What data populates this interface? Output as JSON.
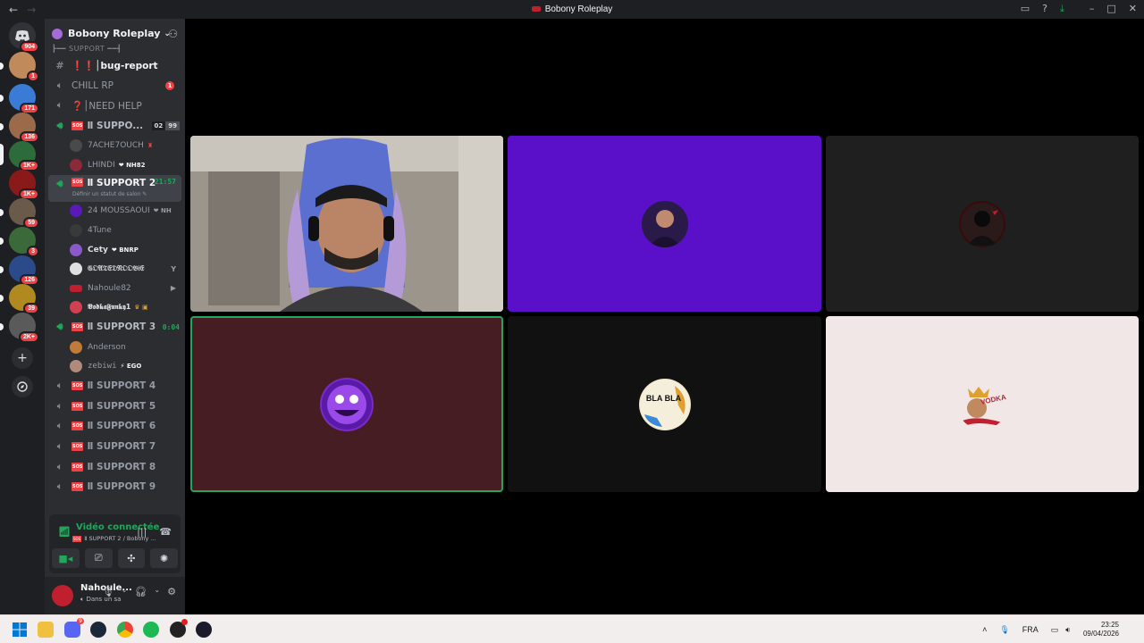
{
  "window": {
    "title": "Bobony Roleplay"
  },
  "guilds": [
    {
      "badge": "904",
      "color": "#5865f2"
    },
    {
      "badge": "1",
      "color": "#c08a5a"
    },
    {
      "badge": "171",
      "color": "#3a7bd5"
    },
    {
      "badge": "136",
      "color": "#9a6a4a"
    },
    {
      "badge": "1K+",
      "color": "#2e6b3a"
    },
    {
      "badge": "1K+",
      "color": "#8a1a1a"
    },
    {
      "badge": "59",
      "color": "#6a5a4a"
    },
    {
      "badge": "3",
      "color": "#3a6a3a"
    },
    {
      "badge": "126",
      "color": "#2a4a8a"
    },
    {
      "badge": "39",
      "color": "#b08a20"
    },
    {
      "badge": "2K+",
      "color": "#5a5a5a"
    }
  ],
  "server": {
    "name": "Bobony Roleplay",
    "category": "SUPPORT"
  },
  "channels": {
    "bug_report": {
      "name": "❗❗│bug-report"
    },
    "chill_rp": {
      "name": "CHILL RP",
      "badge": "1"
    },
    "need_help": {
      "name": "❓│NEED HELP"
    },
    "support1": {
      "name": "Ⅱ SUPPO...",
      "count_a": "02",
      "count_b": "99"
    },
    "support2": {
      "name": "Ⅱ SUPPORT 2",
      "timer": "21:57",
      "status": "Définir un statut de salon ✎"
    },
    "support3": {
      "name": "Ⅱ SUPPORT 3",
      "timer": "0:04"
    },
    "support4": {
      "name": "Ⅱ SUPPORT 4"
    },
    "support5": {
      "name": "Ⅱ SUPPORT 5"
    },
    "support6": {
      "name": "Ⅱ SUPPORT 6"
    },
    "support7": {
      "name": "Ⅱ SUPPORT 7"
    },
    "support8": {
      "name": "Ⅱ SUPPORT 8"
    },
    "support9": {
      "name": "Ⅱ SUPPORT 9"
    },
    "sos_label": "SOS"
  },
  "users": {
    "support1": [
      {
        "name": "7ACHE7OUCH",
        "tag": "♜"
      },
      {
        "name": "LHINDI",
        "tag": "❤ NH82"
      }
    ],
    "support2": [
      {
        "name": "24 MOUSSAOUI",
        "tag": "❤ NH"
      },
      {
        "name": "4Tune",
        "tag": ""
      },
      {
        "name": "Cety",
        "tag": "❤ BNRP"
      },
      {
        "name": "𝔊𝔒𝔄𝔗𝔈𝔇𝔑𝔒𝔒𝔅𝔦𝔈",
        "tag": "Y"
      },
      {
        "name": "Nahoule82",
        "tag": "▶"
      },
      {
        "name": "𝖁𝖔𝖉𝖐𝖆𝕱𝖚𝖓𝖐𝖞1",
        "tag": "♛ ▣"
      }
    ],
    "support3": [
      {
        "name": "Anderson",
        "tag": ""
      },
      {
        "name": "zebiwi",
        "tag": "⚡ EGO"
      }
    ]
  },
  "voice_panel": {
    "status": "Vidéo connectée",
    "location": "Ⅱ SUPPORT 2 / Bobony ..."
  },
  "user_panel": {
    "name": "Nahoule...",
    "status": "Dans un sa"
  },
  "tiles": [
    {
      "kind": "camera",
      "bg": "#6f6a63"
    },
    {
      "kind": "avatar",
      "bg": "#5a0fc8",
      "avatar_color": "#2a1a4a"
    },
    {
      "kind": "avatar",
      "bg": "#1f1f1f",
      "avatar_color": "#3a0a0a"
    },
    {
      "kind": "avatar",
      "bg": "#461d23",
      "avatar_color": "#7a2ac8",
      "speaking": true
    },
    {
      "kind": "avatar",
      "bg": "#111111",
      "avatar_color": "#f0e6c8",
      "avatar_text": "BLA BLA"
    },
    {
      "kind": "avatar",
      "bg": "#f1e7e6",
      "avatar_color": "#c02030",
      "avatar_text": "VODKA"
    }
  ],
  "taskbar": {
    "language": "FRA",
    "time": "23:25",
    "date": "09/04/2026",
    "discord_badge": "9"
  }
}
